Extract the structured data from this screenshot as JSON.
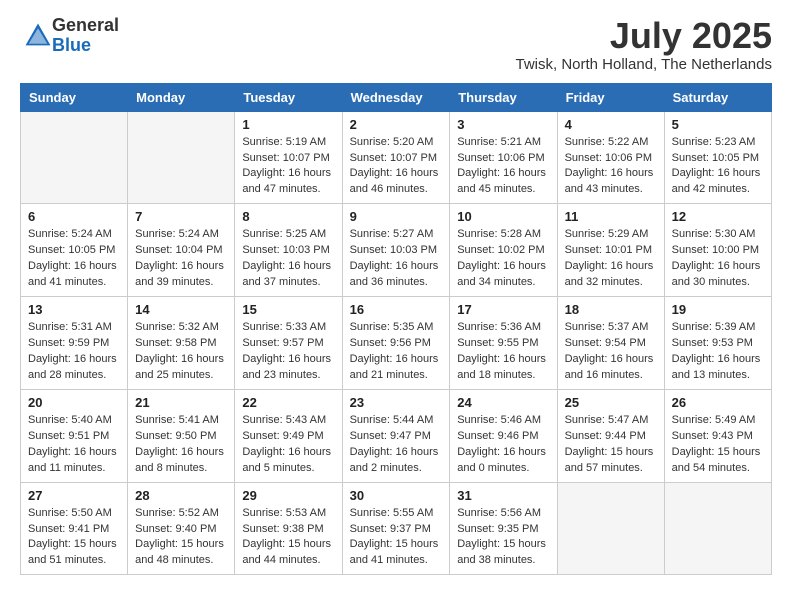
{
  "logo": {
    "general": "General",
    "blue": "Blue"
  },
  "title": "July 2025",
  "location": "Twisk, North Holland, The Netherlands",
  "days_of_week": [
    "Sunday",
    "Monday",
    "Tuesday",
    "Wednesday",
    "Thursday",
    "Friday",
    "Saturday"
  ],
  "weeks": [
    [
      {
        "day": "",
        "info": ""
      },
      {
        "day": "",
        "info": ""
      },
      {
        "day": "1",
        "info": "Sunrise: 5:19 AM\nSunset: 10:07 PM\nDaylight: 16 hours\nand 47 minutes."
      },
      {
        "day": "2",
        "info": "Sunrise: 5:20 AM\nSunset: 10:07 PM\nDaylight: 16 hours\nand 46 minutes."
      },
      {
        "day": "3",
        "info": "Sunrise: 5:21 AM\nSunset: 10:06 PM\nDaylight: 16 hours\nand 45 minutes."
      },
      {
        "day": "4",
        "info": "Sunrise: 5:22 AM\nSunset: 10:06 PM\nDaylight: 16 hours\nand 43 minutes."
      },
      {
        "day": "5",
        "info": "Sunrise: 5:23 AM\nSunset: 10:05 PM\nDaylight: 16 hours\nand 42 minutes."
      }
    ],
    [
      {
        "day": "6",
        "info": "Sunrise: 5:24 AM\nSunset: 10:05 PM\nDaylight: 16 hours\nand 41 minutes."
      },
      {
        "day": "7",
        "info": "Sunrise: 5:24 AM\nSunset: 10:04 PM\nDaylight: 16 hours\nand 39 minutes."
      },
      {
        "day": "8",
        "info": "Sunrise: 5:25 AM\nSunset: 10:03 PM\nDaylight: 16 hours\nand 37 minutes."
      },
      {
        "day": "9",
        "info": "Sunrise: 5:27 AM\nSunset: 10:03 PM\nDaylight: 16 hours\nand 36 minutes."
      },
      {
        "day": "10",
        "info": "Sunrise: 5:28 AM\nSunset: 10:02 PM\nDaylight: 16 hours\nand 34 minutes."
      },
      {
        "day": "11",
        "info": "Sunrise: 5:29 AM\nSunset: 10:01 PM\nDaylight: 16 hours\nand 32 minutes."
      },
      {
        "day": "12",
        "info": "Sunrise: 5:30 AM\nSunset: 10:00 PM\nDaylight: 16 hours\nand 30 minutes."
      }
    ],
    [
      {
        "day": "13",
        "info": "Sunrise: 5:31 AM\nSunset: 9:59 PM\nDaylight: 16 hours\nand 28 minutes."
      },
      {
        "day": "14",
        "info": "Sunrise: 5:32 AM\nSunset: 9:58 PM\nDaylight: 16 hours\nand 25 minutes."
      },
      {
        "day": "15",
        "info": "Sunrise: 5:33 AM\nSunset: 9:57 PM\nDaylight: 16 hours\nand 23 minutes."
      },
      {
        "day": "16",
        "info": "Sunrise: 5:35 AM\nSunset: 9:56 PM\nDaylight: 16 hours\nand 21 minutes."
      },
      {
        "day": "17",
        "info": "Sunrise: 5:36 AM\nSunset: 9:55 PM\nDaylight: 16 hours\nand 18 minutes."
      },
      {
        "day": "18",
        "info": "Sunrise: 5:37 AM\nSunset: 9:54 PM\nDaylight: 16 hours\nand 16 minutes."
      },
      {
        "day": "19",
        "info": "Sunrise: 5:39 AM\nSunset: 9:53 PM\nDaylight: 16 hours\nand 13 minutes."
      }
    ],
    [
      {
        "day": "20",
        "info": "Sunrise: 5:40 AM\nSunset: 9:51 PM\nDaylight: 16 hours\nand 11 minutes."
      },
      {
        "day": "21",
        "info": "Sunrise: 5:41 AM\nSunset: 9:50 PM\nDaylight: 16 hours\nand 8 minutes."
      },
      {
        "day": "22",
        "info": "Sunrise: 5:43 AM\nSunset: 9:49 PM\nDaylight: 16 hours\nand 5 minutes."
      },
      {
        "day": "23",
        "info": "Sunrise: 5:44 AM\nSunset: 9:47 PM\nDaylight: 16 hours\nand 2 minutes."
      },
      {
        "day": "24",
        "info": "Sunrise: 5:46 AM\nSunset: 9:46 PM\nDaylight: 16 hours\nand 0 minutes."
      },
      {
        "day": "25",
        "info": "Sunrise: 5:47 AM\nSunset: 9:44 PM\nDaylight: 15 hours\nand 57 minutes."
      },
      {
        "day": "26",
        "info": "Sunrise: 5:49 AM\nSunset: 9:43 PM\nDaylight: 15 hours\nand 54 minutes."
      }
    ],
    [
      {
        "day": "27",
        "info": "Sunrise: 5:50 AM\nSunset: 9:41 PM\nDaylight: 15 hours\nand 51 minutes."
      },
      {
        "day": "28",
        "info": "Sunrise: 5:52 AM\nSunset: 9:40 PM\nDaylight: 15 hours\nand 48 minutes."
      },
      {
        "day": "29",
        "info": "Sunrise: 5:53 AM\nSunset: 9:38 PM\nDaylight: 15 hours\nand 44 minutes."
      },
      {
        "day": "30",
        "info": "Sunrise: 5:55 AM\nSunset: 9:37 PM\nDaylight: 15 hours\nand 41 minutes."
      },
      {
        "day": "31",
        "info": "Sunrise: 5:56 AM\nSunset: 9:35 PM\nDaylight: 15 hours\nand 38 minutes."
      },
      {
        "day": "",
        "info": ""
      },
      {
        "day": "",
        "info": ""
      }
    ]
  ]
}
